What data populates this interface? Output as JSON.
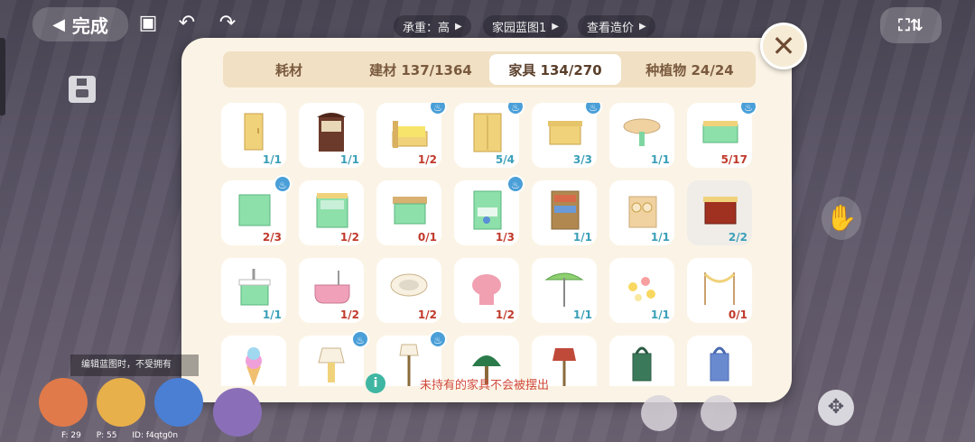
{
  "top": {
    "done_label": "完成",
    "done_arrow": "◀",
    "book_icon": "▣",
    "undo_icon": "↶",
    "redo_icon": "↷",
    "pills": [
      "承重：高",
      "家园蓝图1",
      "查看造价"
    ],
    "pill_arrow": "▶",
    "view_icon": "⛶⇅"
  },
  "panel": {
    "close_icon": "✕",
    "tabs": [
      "耗材",
      "建材 137/1364",
      "家具 134/270",
      "种植物 24/24"
    ],
    "active_tab": 2,
    "notice": "未持有的家具不会被摆出",
    "info_icon": "i"
  },
  "items": [
    {
      "count": "1/1",
      "color": "#3a9fb8",
      "img": "cabinet",
      "badge": false
    },
    {
      "count": "1/1",
      "color": "#3a9fb8",
      "img": "hutch",
      "badge": false
    },
    {
      "count": "1/2",
      "color": "#c0392b",
      "img": "bed",
      "badge": true
    },
    {
      "count": "5/4",
      "color": "#3a9fb8",
      "img": "wardrobe",
      "badge": true
    },
    {
      "count": "3/3",
      "color": "#3a9fb8",
      "img": "nightstand",
      "badge": true
    },
    {
      "count": "1/1",
      "color": "#3a9fb8",
      "img": "table",
      "badge": false
    },
    {
      "count": "5/17",
      "color": "#c0392b",
      "img": "drawer",
      "badge": true
    },
    {
      "count": "2/3",
      "color": "#c0392b",
      "img": "greencab",
      "badge": true
    },
    {
      "count": "1/2",
      "color": "#c0392b",
      "img": "dresser",
      "badge": false
    },
    {
      "count": "0/1",
      "color": "#c0392b",
      "img": "desk",
      "badge": false
    },
    {
      "count": "1/3",
      "color": "#c0392b",
      "img": "shelf",
      "badge": true
    },
    {
      "count": "1/1",
      "color": "#3a9fb8",
      "img": "bookcase",
      "badge": false
    },
    {
      "count": "1/1",
      "color": "#3a9fb8",
      "img": "plates",
      "badge": false
    },
    {
      "count": "2/2",
      "color": "#3a9fb8",
      "img": "redchest",
      "badge": false
    },
    {
      "count": "1/1",
      "color": "#3a9fb8",
      "img": "sink",
      "badge": false
    },
    {
      "count": "1/2",
      "color": "#c0392b",
      "img": "bathtub",
      "badge": false
    },
    {
      "count": "1/2",
      "color": "#c0392b",
      "img": "basin",
      "badge": false
    },
    {
      "count": "1/2",
      "color": "#c0392b",
      "img": "toilet",
      "badge": false
    },
    {
      "count": "1/1",
      "color": "#3a9fb8",
      "img": "umbrella",
      "badge": false
    },
    {
      "count": "1/1",
      "color": "#3a9fb8",
      "img": "flowers",
      "badge": false
    },
    {
      "count": "0/1",
      "color": "#c0392b",
      "img": "garland",
      "badge": false
    },
    {
      "count": "",
      "color": "#3a9fb8",
      "img": "icecream",
      "badge": false
    },
    {
      "count": "",
      "color": "#3a9fb8",
      "img": "lamp",
      "badge": true
    },
    {
      "count": "",
      "color": "#3a9fb8",
      "img": "floorlamp",
      "badge": true
    },
    {
      "count": "",
      "color": "#3a9fb8",
      "img": "greenlamp",
      "badge": false
    },
    {
      "count": "",
      "color": "#3a9fb8",
      "img": "redlamp",
      "badge": false
    },
    {
      "count": "",
      "color": "#3a9fb8",
      "img": "lantern",
      "badge": false
    },
    {
      "count": "",
      "color": "#3a9fb8",
      "img": "bluelantern",
      "badge": false
    }
  ],
  "bottom": {
    "tip": "编辑蓝图时，不受拥有",
    "coords": [
      "F: 29",
      "P: 55",
      "ID: f4qtg0n"
    ],
    "person_icon": "✋",
    "move_icon": "✥"
  }
}
